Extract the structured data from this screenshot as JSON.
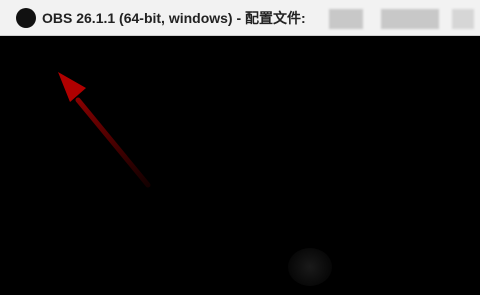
{
  "window": {
    "title": "OBS 26.1.1 (64-bit, windows) - 配置文件:",
    "icon": "obs-logo-icon"
  },
  "menubar": {
    "items": [
      "",
      "",
      "",
      "",
      "",
      ""
    ]
  },
  "annotation": {
    "arrow_color": "#8b0000"
  }
}
